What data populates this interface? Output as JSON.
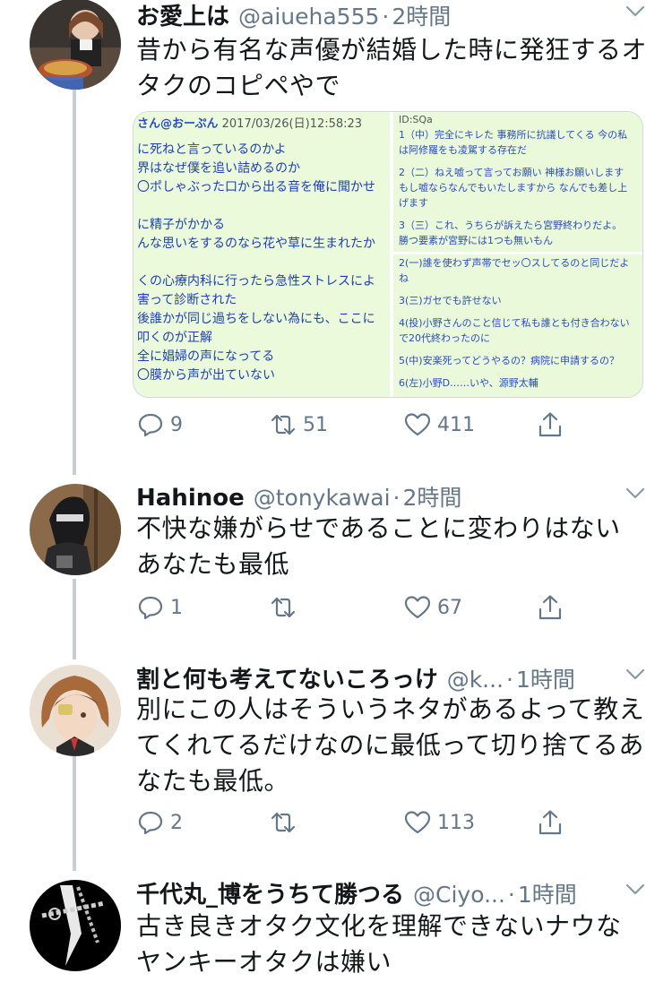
{
  "tweets": [
    {
      "name": "お愛上は",
      "handle": "@aiueha555",
      "dot": "·",
      "time": "2時間",
      "text_lines": [
        "昔から有名な声優が結婚した時に発狂するオ",
        "タクのコピペやで"
      ],
      "replies": "9",
      "retweets": "51",
      "likes": "411",
      "media": {
        "left_header_user": "さん@おーぷん",
        "left_header_date": "2017/03/26(日)12:58:23",
        "left_lines": [
          "に死ねと言っているのかよ",
          "界はなぜ僕を追い詰めるのか",
          "〇ポしゃぶった口から出る音を俺に聞かせ",
          "",
          "に精子がかかる",
          "んな思いをするのなら花や草に生まれたか",
          "",
          "くの心療内科に行ったら急性ストレスによ",
          "害って診断された",
          "後誰かが同じ過ちをしない為にも、ここに",
          "叩くのが正解",
          "全に娼婦の声になってる",
          "〇膜から声が出ていない"
        ],
        "right_top_lines": [
          "ID:SQa",
          "1（中）完全にキレた 事務所に抗議してくる 今の私",
          "は阿修羅をも凌駕する存在だ",
          "",
          "2（二）ねえ嘘って言ってお願い 神様お願いします",
          "もし嘘ならなんでもいたしますから なんでも差し上",
          "げます",
          "",
          "3（三）これ、うちらが訴えたら宮野終わりだよ。",
          "勝つ要素が宮野には1つも無いもん"
        ],
        "right_bottom_lines": [
          "2(一)誰を使わず声帯でセッ〇スしてるのと同じだよ",
          "ね",
          "",
          "3(三)ガセでも許せない",
          "",
          "4(投)小野さんのこと信じて私も誰とも付き合わない",
          "で20代終わったのに",
          "",
          "5(中)安楽死ってどうやるの？病院に申請するの？",
          "",
          "6(左)小野D……いや、源野太輔"
        ]
      }
    },
    {
      "name": "Hahinoe",
      "handle": "@tonykawai",
      "dot": "·",
      "time": "2時間",
      "text_lines": [
        "不快な嫌がらせであることに変わりはない",
        "あなたも最低"
      ],
      "replies": "1",
      "retweets": "",
      "likes": "67"
    },
    {
      "name": "割と何も考えてないころっけ",
      "handle": "@k...",
      "dot": "·",
      "time": "1時間",
      "text_lines": [
        "別にこの人はそういうネタがあるよって教え",
        "てくれてるだけなのに最低って切り捨てるあ",
        "なたも最低。"
      ],
      "replies": "2",
      "retweets": "",
      "likes": "113"
    },
    {
      "name": "千代丸_博をうちて勝つる",
      "handle": "@Ciyo...",
      "dot": "·",
      "time": "1時間",
      "text_lines": [
        "古き良きオタク文化を理解できないナウな",
        "ヤンキーオタクは嫌い"
      ]
    }
  ],
  "icons": {
    "reply": "reply-icon",
    "retweet": "retweet-icon",
    "like": "heart-icon",
    "share": "share-icon",
    "caret": "chevron-down-icon"
  },
  "colors": {
    "text": "#14171a",
    "secondary": "#657786",
    "thread_line": "#c4cfd6",
    "media_bg": "#eafadb",
    "media_text": "#1f3fb4"
  }
}
